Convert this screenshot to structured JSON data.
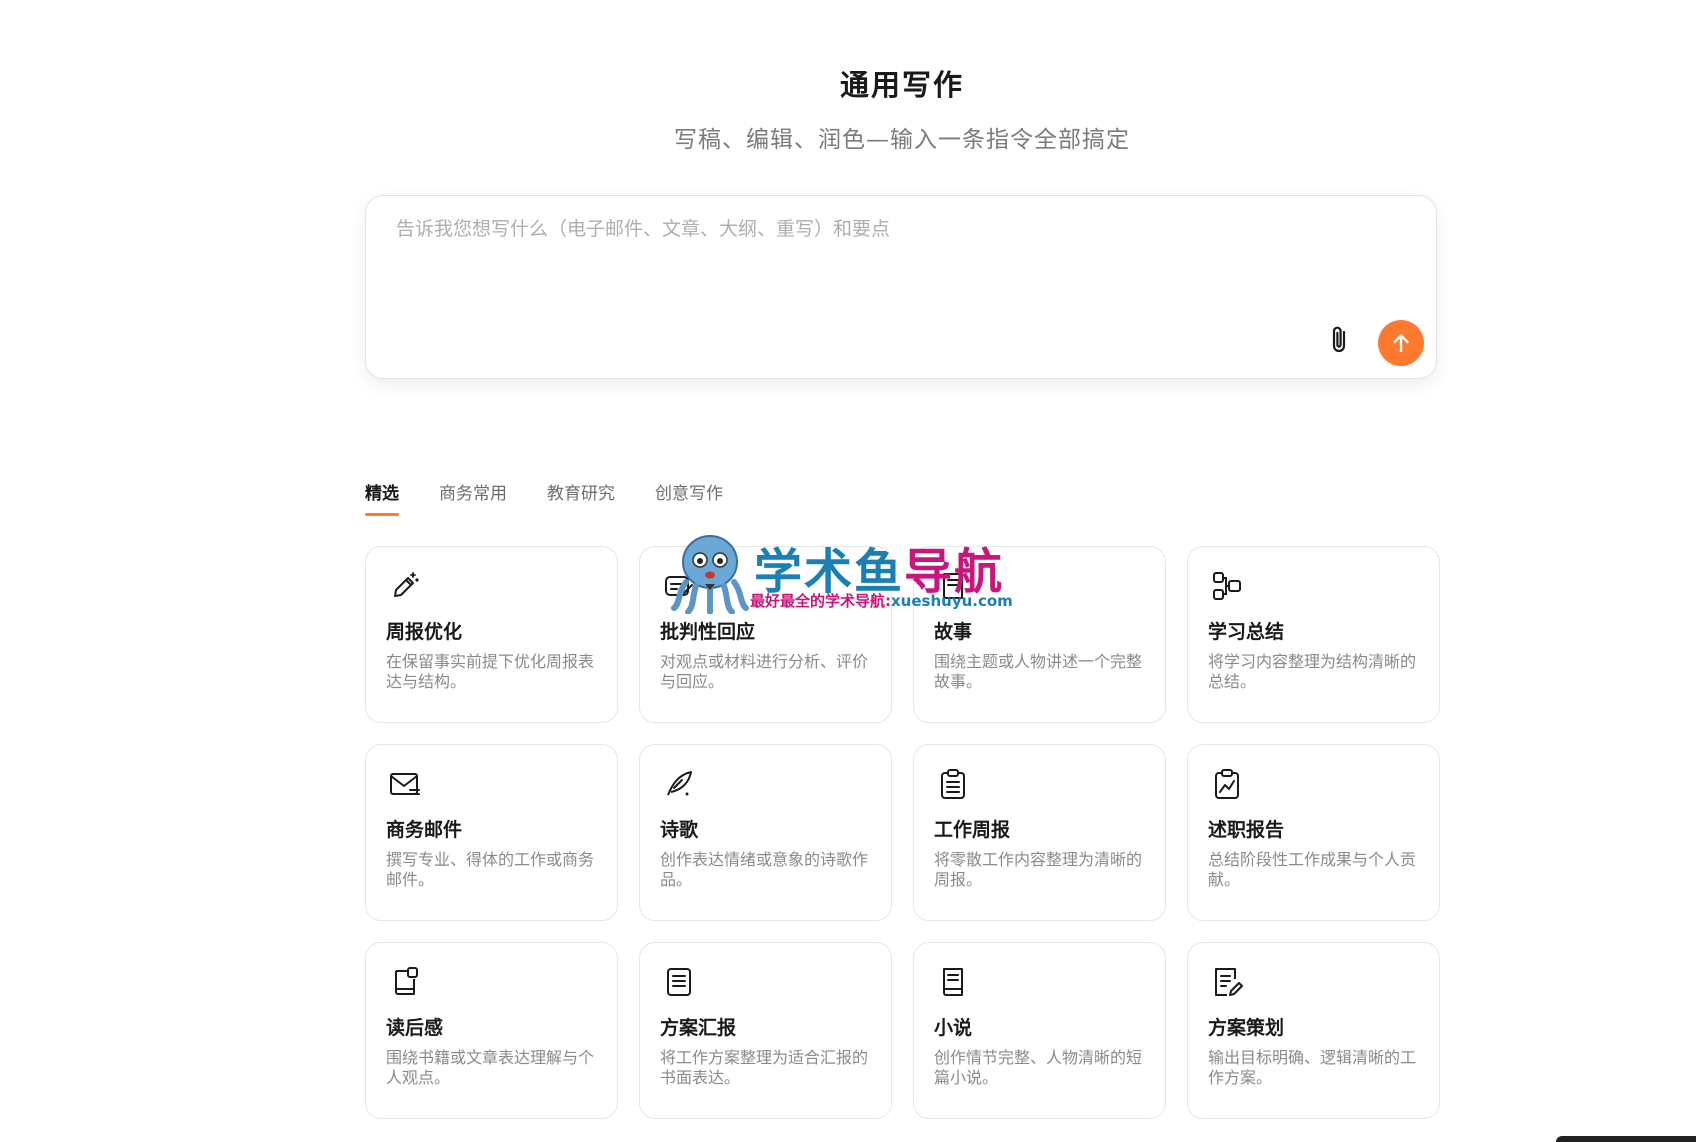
{
  "header": {
    "title": "通用写作",
    "subtitle": "写稿、编辑、润色—输入一条指令全部搞定"
  },
  "prompt": {
    "placeholder": "告诉我您想写什么（电子邮件、文章、大纲、重写）和要点",
    "value": "",
    "attach_icon": "paperclip-icon",
    "send_icon": "arrow-up-icon"
  },
  "tabs": [
    {
      "label": "精选",
      "active": true
    },
    {
      "label": "商务常用",
      "active": false
    },
    {
      "label": "教育研究",
      "active": false
    },
    {
      "label": "创意写作",
      "active": false
    }
  ],
  "cards": [
    {
      "title": "周报优化",
      "desc": "在保留事实前提下优化周报表达与结构。",
      "icon": "magic-pen-icon"
    },
    {
      "title": "批判性回应",
      "desc": "对观点或材料进行分析、评价与回应。",
      "icon": "comment-edit-icon"
    },
    {
      "title": "故事",
      "desc": "围绕主题或人物讲述一个完整故事。",
      "icon": "book-icon"
    },
    {
      "title": "学习总结",
      "desc": "将学习内容整理为结构清晰的总结。",
      "icon": "structure-icon"
    },
    {
      "title": "商务邮件",
      "desc": "撰写专业、得体的工作或商务邮件。",
      "icon": "mail-icon"
    },
    {
      "title": "诗歌",
      "desc": "创作表达情绪或意象的诗歌作品。",
      "icon": "quill-icon"
    },
    {
      "title": "工作周报",
      "desc": "将零散工作内容整理为清晰的周报。",
      "icon": "clipboard-list-icon"
    },
    {
      "title": "述职报告",
      "desc": "总结阶段性工作成果与个人贡献。",
      "icon": "clipboard-chart-icon"
    },
    {
      "title": "读后感",
      "desc": "围绕书籍或文章表达理解与个人观点。",
      "icon": "book-note-icon"
    },
    {
      "title": "方案汇报",
      "desc": "将工作方案整理为适合汇报的书面表达。",
      "icon": "document-icon"
    },
    {
      "title": "小说",
      "desc": "创作情节完整、人物清晰的短篇小说。",
      "icon": "notebook-icon"
    },
    {
      "title": "方案策划",
      "desc": "输出目标明确、逻辑清晰的工作方案。",
      "icon": "document-edit-icon"
    }
  ],
  "watermark": {
    "title_part1": "学术鱼",
    "title_part2": "导航",
    "sub_part1": "最好最全的学术导航:",
    "sub_part2": "xueshuyu.com"
  },
  "colors": {
    "accent": "#ff7a2f",
    "text": "#1a1a1a",
    "muted": "#8a8a8a",
    "border": "#e6e6e6"
  }
}
